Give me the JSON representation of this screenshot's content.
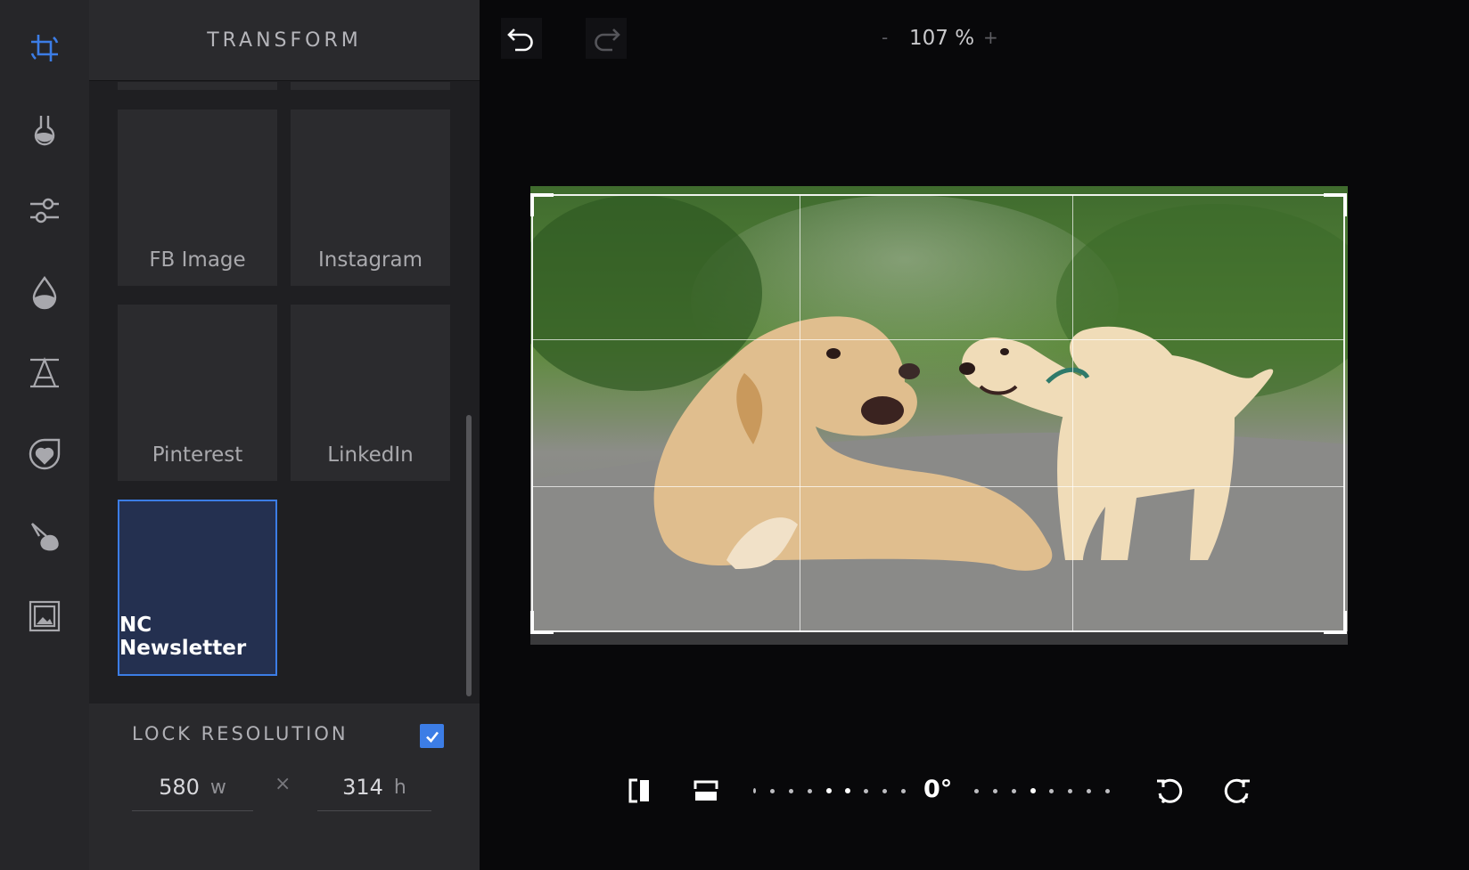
{
  "panel": {
    "title": "TRANSFORM",
    "presets": [
      {
        "label": "FB Image"
      },
      {
        "label": "Instagram"
      },
      {
        "label": "Pinterest"
      },
      {
        "label": "LinkedIn"
      },
      {
        "label": "NC Newsletter",
        "selected": true
      }
    ],
    "lock_resolution": {
      "label": "LOCK RESOLUTION",
      "checked": true,
      "width_value": "580",
      "width_unit": "w",
      "separator": "×",
      "height_value": "314",
      "height_unit": "h"
    }
  },
  "toolbar": {
    "tools": [
      "crop-transform-icon",
      "filter-flask-icon",
      "adjust-sliders-icon",
      "color-drop-icon",
      "text-icon",
      "sticker-heart-icon",
      "brush-icon",
      "frame-icon"
    ],
    "active_tool": "crop-transform-icon"
  },
  "topbar": {
    "zoom_minus": "-",
    "zoom_value": "107 %",
    "zoom_plus": "+"
  },
  "canvas": {
    "image_subject": "Two labrador dogs on a paved path"
  },
  "rotation": {
    "angle": "0°"
  },
  "colors": {
    "accent": "#3c7de6",
    "panel_bg": "#1f1f22",
    "toolbar_bg": "#262629",
    "canvas_bg": "#08080a"
  }
}
